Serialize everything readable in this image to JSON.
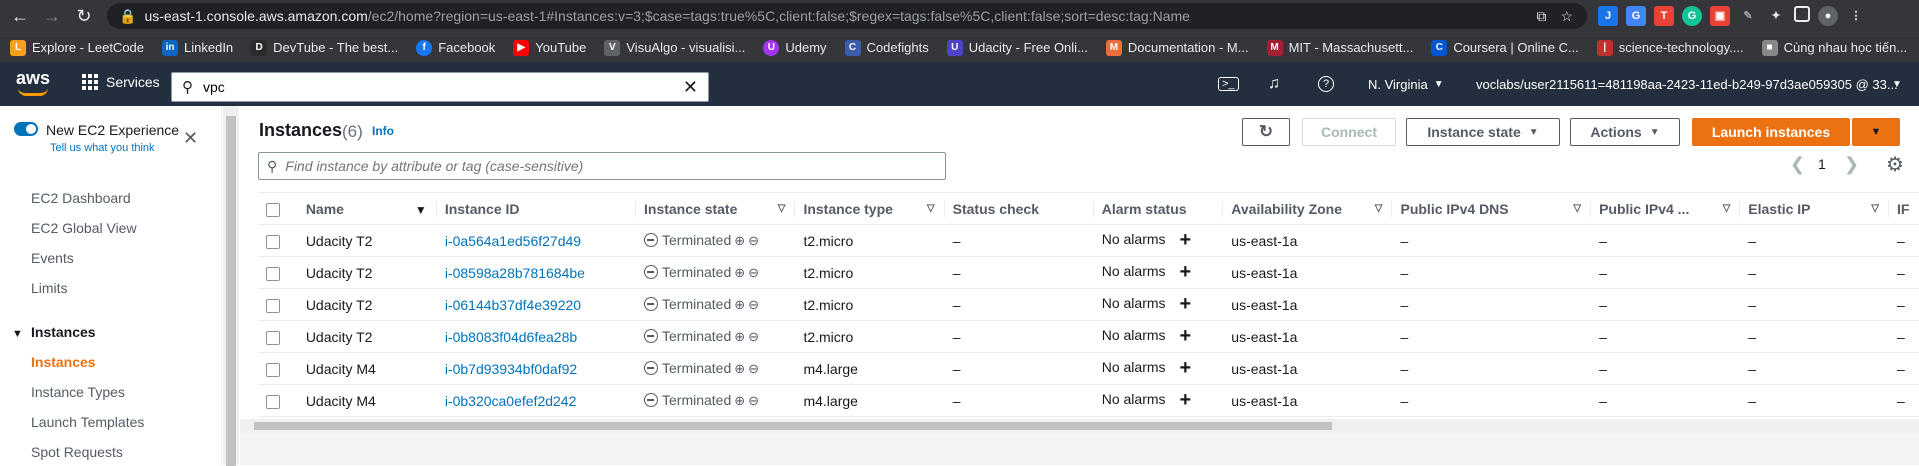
{
  "browser": {
    "url_host": "us-east-1.console.aws.amazon.com",
    "url_path": "/ec2/home?region=us-east-1#Instances:v=3;$case=tags:true%5C,client:false;$regex=tags:false%5C,client:false;sort=desc:tag:Name",
    "bookmarks": [
      "Explore - LeetCode",
      "LinkedIn",
      "DevTube - The best...",
      "Facebook",
      "YouTube",
      "VisuAlgo - visualisi...",
      "Udemy",
      "Codefights",
      "Udacity - Free Onli...",
      "Documentation - M...",
      "MIT - Massachusett...",
      "Coursera | Online C...",
      "science-technology....",
      "Cùng nhau học tiến..."
    ]
  },
  "aws_header": {
    "logo": "aws",
    "services_label": "Services",
    "search_value": "vpc",
    "region": "N. Virginia",
    "account": "voclabs/user2115611=481198aa-2423-11ed-b249-97d3ae059305 @ 33..."
  },
  "sidebar": {
    "new_experience": "New EC2 Experience",
    "tell_us": "Tell us what you think",
    "items": [
      "EC2 Dashboard",
      "EC2 Global View",
      "Events",
      "Limits"
    ],
    "section": "Instances",
    "section_items": [
      "Instances",
      "Instance Types",
      "Launch Templates",
      "Spot Requests"
    ]
  },
  "main": {
    "title": "Instances",
    "count": "(6)",
    "info": "Info",
    "connect": "Connect",
    "instance_state": "Instance state",
    "actions": "Actions",
    "launch": "Launch instances",
    "filter_placeholder": "Find instance by attribute or tag (case-sensitive)",
    "page": "1",
    "columns": [
      "Name",
      "Instance ID",
      "Instance state",
      "Instance type",
      "Status check",
      "Alarm status",
      "Availability Zone",
      "Public IPv4 DNS",
      "Public IPv4 ...",
      "Elastic IP",
      "IF"
    ],
    "rows": [
      {
        "name": "Udacity T2",
        "id": "i-0a564a1ed56f27d49",
        "state": "Terminated",
        "type": "t2.micro",
        "status": "–",
        "alarm": "No alarms",
        "az": "us-east-1a",
        "dns": "–",
        "ip": "–",
        "eip": "–",
        "ipv6": "–"
      },
      {
        "name": "Udacity T2",
        "id": "i-08598a28b781684be",
        "state": "Terminated",
        "type": "t2.micro",
        "status": "–",
        "alarm": "No alarms",
        "az": "us-east-1a",
        "dns": "–",
        "ip": "–",
        "eip": "–",
        "ipv6": "–"
      },
      {
        "name": "Udacity T2",
        "id": "i-06144b37df4e39220",
        "state": "Terminated",
        "type": "t2.micro",
        "status": "–",
        "alarm": "No alarms",
        "az": "us-east-1a",
        "dns": "–",
        "ip": "–",
        "eip": "–",
        "ipv6": "–"
      },
      {
        "name": "Udacity T2",
        "id": "i-0b8083f04d6fea28b",
        "state": "Terminated",
        "type": "t2.micro",
        "status": "–",
        "alarm": "No alarms",
        "az": "us-east-1a",
        "dns": "–",
        "ip": "–",
        "eip": "–",
        "ipv6": "–"
      },
      {
        "name": "Udacity M4",
        "id": "i-0b7d93934bf0daf92",
        "state": "Terminated",
        "type": "m4.large",
        "status": "–",
        "alarm": "No alarms",
        "az": "us-east-1a",
        "dns": "–",
        "ip": "–",
        "eip": "–",
        "ipv6": "–"
      },
      {
        "name": "Udacity M4",
        "id": "i-0b320ca0efef2d242",
        "state": "Terminated",
        "type": "m4.large",
        "status": "–",
        "alarm": "No alarms",
        "az": "us-east-1a",
        "dns": "–",
        "ip": "–",
        "eip": "–",
        "ipv6": "–"
      }
    ]
  },
  "colors": {
    "aws_nav": "#232f3e",
    "accent": "#ec7211",
    "link": "#0073bb"
  }
}
